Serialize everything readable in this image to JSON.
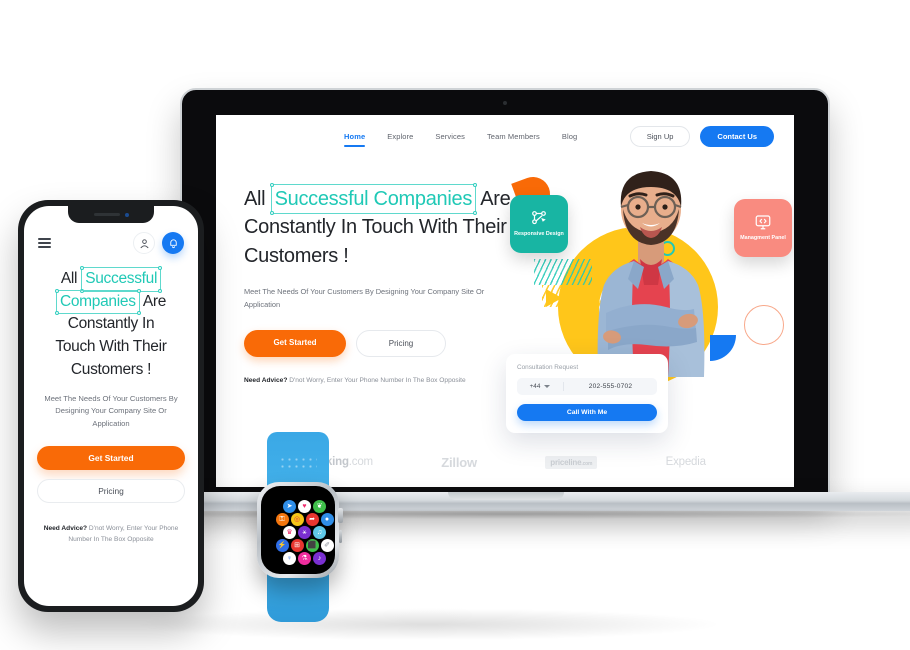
{
  "laptop": {
    "nav": {
      "links": [
        {
          "label": "Home",
          "active": true
        },
        {
          "label": "Explore",
          "active": false
        },
        {
          "label": "Services",
          "active": false
        },
        {
          "label": "Team Members",
          "active": false
        },
        {
          "label": "Blog",
          "active": false
        }
      ],
      "signup_label": "Sign Up",
      "contact_label": "Contact Us"
    },
    "hero": {
      "headline_pre": "All",
      "headline_highlight": "Successful Companies",
      "headline_post": "Are",
      "headline_line2": "Constantly In Touch With Their",
      "headline_line3": "Customers !",
      "subtitle": "Meet The Needs Of Your Customers By Designing Your Company Site Or Application",
      "btn_primary": "Get Started",
      "btn_secondary": "Pricing",
      "advice_bold": "Need Advice?",
      "advice_rest": "D'not Worry, Enter Your Phone Number In The Box Opposite"
    },
    "cards": [
      {
        "label": "Responsive Design",
        "icon": "nodes-icon",
        "color": "#18b5a3"
      },
      {
        "label": "Managment Panel",
        "icon": "code-monitor-icon",
        "color": "#f98b80"
      }
    ],
    "consult": {
      "title": "Consultation Request",
      "country_code": "+44",
      "phone": "202-555-0702",
      "button": "Call With Me"
    },
    "brands": [
      {
        "name": "Booking",
        "suffix": ".com"
      },
      {
        "name": "Zillow",
        "suffix": ""
      },
      {
        "name": "priceline",
        "suffix": ".com"
      },
      {
        "name": "Expedia",
        "suffix": ""
      }
    ]
  },
  "phone": {
    "headline_pre": "All",
    "headline_h1": "Successful",
    "headline_h2": "Companies",
    "headline_post": "Are",
    "headline_line2": "Constantly In",
    "headline_line3": "Touch With Their",
    "headline_line4": "Customers !",
    "subtitle": "Meet The Needs Of Your Customers By Designing Your Company Site Or Application",
    "btn_primary": "Get Started",
    "btn_secondary": "Pricing",
    "advice_bold": "Need Advice?",
    "advice_rest": "D'not Worry, Enter Your Phone Number In The Box Opposite"
  },
  "watch": {
    "apps": [
      {
        "name": "navigation-icon",
        "glyph": "➤",
        "bg": "#2f8ee8",
        "fg": "#ffffff"
      },
      {
        "name": "heart-icon",
        "glyph": "♥",
        "bg": "#ffffff",
        "fg": "#ef2d6e"
      },
      {
        "name": "leaf-icon",
        "glyph": "❦",
        "bg": "#3fbf4a",
        "fg": "#ffffff"
      },
      {
        "name": "lock-icon",
        "glyph": "⚿",
        "bg": "#f4760e",
        "fg": "#ffffff"
      },
      {
        "name": "target-icon",
        "glyph": "◎",
        "bg": "#f5c518",
        "fg": "#e0383e"
      },
      {
        "name": "compass-icon",
        "glyph": "➦",
        "bg": "#e8362f",
        "fg": "#ffffff"
      },
      {
        "name": "message-icon",
        "glyph": "●",
        "bg": "#2f8ee8",
        "fg": "#ffffff"
      },
      {
        "name": "crown-icon",
        "glyph": "♛",
        "bg": "#ffffff",
        "fg": "#ef2d6e"
      },
      {
        "name": "gamepad-icon",
        "glyph": "⚹",
        "bg": "#7a2fd1",
        "fg": "#ffffff"
      },
      {
        "name": "headphones-icon",
        "glyph": "♫",
        "bg": "#5fc8e8",
        "fg": "#ffffff"
      },
      {
        "name": "bolt-icon",
        "glyph": "⚡",
        "bg": "#2f6ee8",
        "fg": "#f5e03a"
      },
      {
        "name": "gift-icon",
        "glyph": "⊞",
        "bg": "#e8362f",
        "fg": "#ffffff"
      },
      {
        "name": "camera-icon",
        "glyph": "⬛",
        "bg": "#3fbf4a",
        "fg": "#ffffff"
      },
      {
        "name": "paperclip-icon",
        "glyph": "✐",
        "bg": "#ffffff",
        "fg": "#8a8f98"
      },
      {
        "name": "microphone-icon",
        "glyph": "♀",
        "bg": "#ffffff",
        "fg": "#2f6ee8"
      },
      {
        "name": "flask-icon",
        "glyph": "⚗",
        "bg": "#ef2d9e",
        "fg": "#ffffff"
      },
      {
        "name": "music-icon",
        "glyph": "♪",
        "bg": "#7a2fd1",
        "fg": "#ffffff"
      }
    ]
  }
}
